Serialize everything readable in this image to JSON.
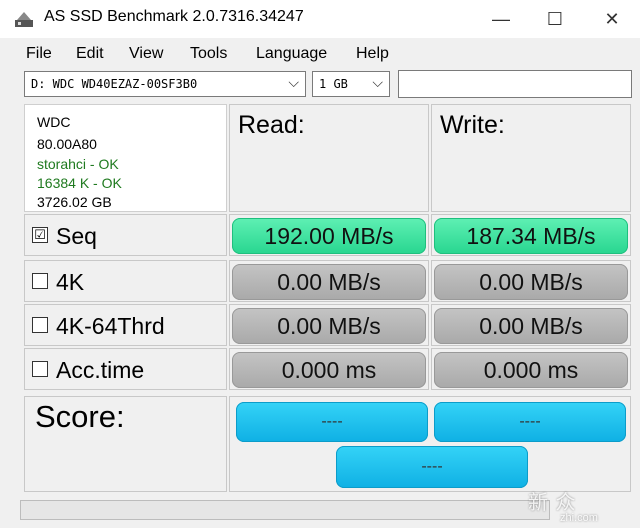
{
  "window": {
    "title": "AS SSD Benchmark 2.0.7316.34247",
    "minimize_glyph": "—",
    "maximize_glyph": "☐",
    "close_glyph": "✕"
  },
  "menu": {
    "items": [
      "File",
      "Edit",
      "View",
      "Tools",
      "Language",
      "Help"
    ]
  },
  "toolbar": {
    "drive_value": "D: WDC WD40EZAZ-00SF3B0",
    "size_value": "1 GB",
    "extra_input_value": "",
    "dropdown_glyph": "⌵"
  },
  "drive_info": {
    "vendor": "WDC",
    "firmware": "80.00A80",
    "driver_status": "storahci - OK",
    "alignment_status": "16384 K - OK",
    "capacity": "3726.02 GB"
  },
  "headers": {
    "read": "Read:",
    "write": "Write:"
  },
  "rows": [
    {
      "label": "Seq",
      "checked": true,
      "check_glyph": "☑",
      "read": "192.00 MB/s",
      "write": "187.34 MB/s"
    },
    {
      "label": "4K",
      "checked": false,
      "check_glyph": "",
      "read": "0.00 MB/s",
      "write": "0.00 MB/s"
    },
    {
      "label": "4K-64Thrd",
      "checked": false,
      "check_glyph": "",
      "read": "0.00 MB/s",
      "write": "0.00 MB/s"
    },
    {
      "label": "Acc.time",
      "checked": false,
      "check_glyph": "",
      "read": "0.000 ms",
      "write": "0.000 ms"
    }
  ],
  "score": {
    "label": "Score:",
    "read": "----",
    "write": "----",
    "total": "----"
  },
  "progress": {
    "fraction": 0.0
  },
  "watermark": {
    "text": "新 众",
    "url": "zhi.com"
  },
  "colors": {
    "active_result": "#28d690",
    "idle_result": "#a9a9a9",
    "score": "#0fb0e4",
    "ok_text": "#1f7a1f"
  }
}
